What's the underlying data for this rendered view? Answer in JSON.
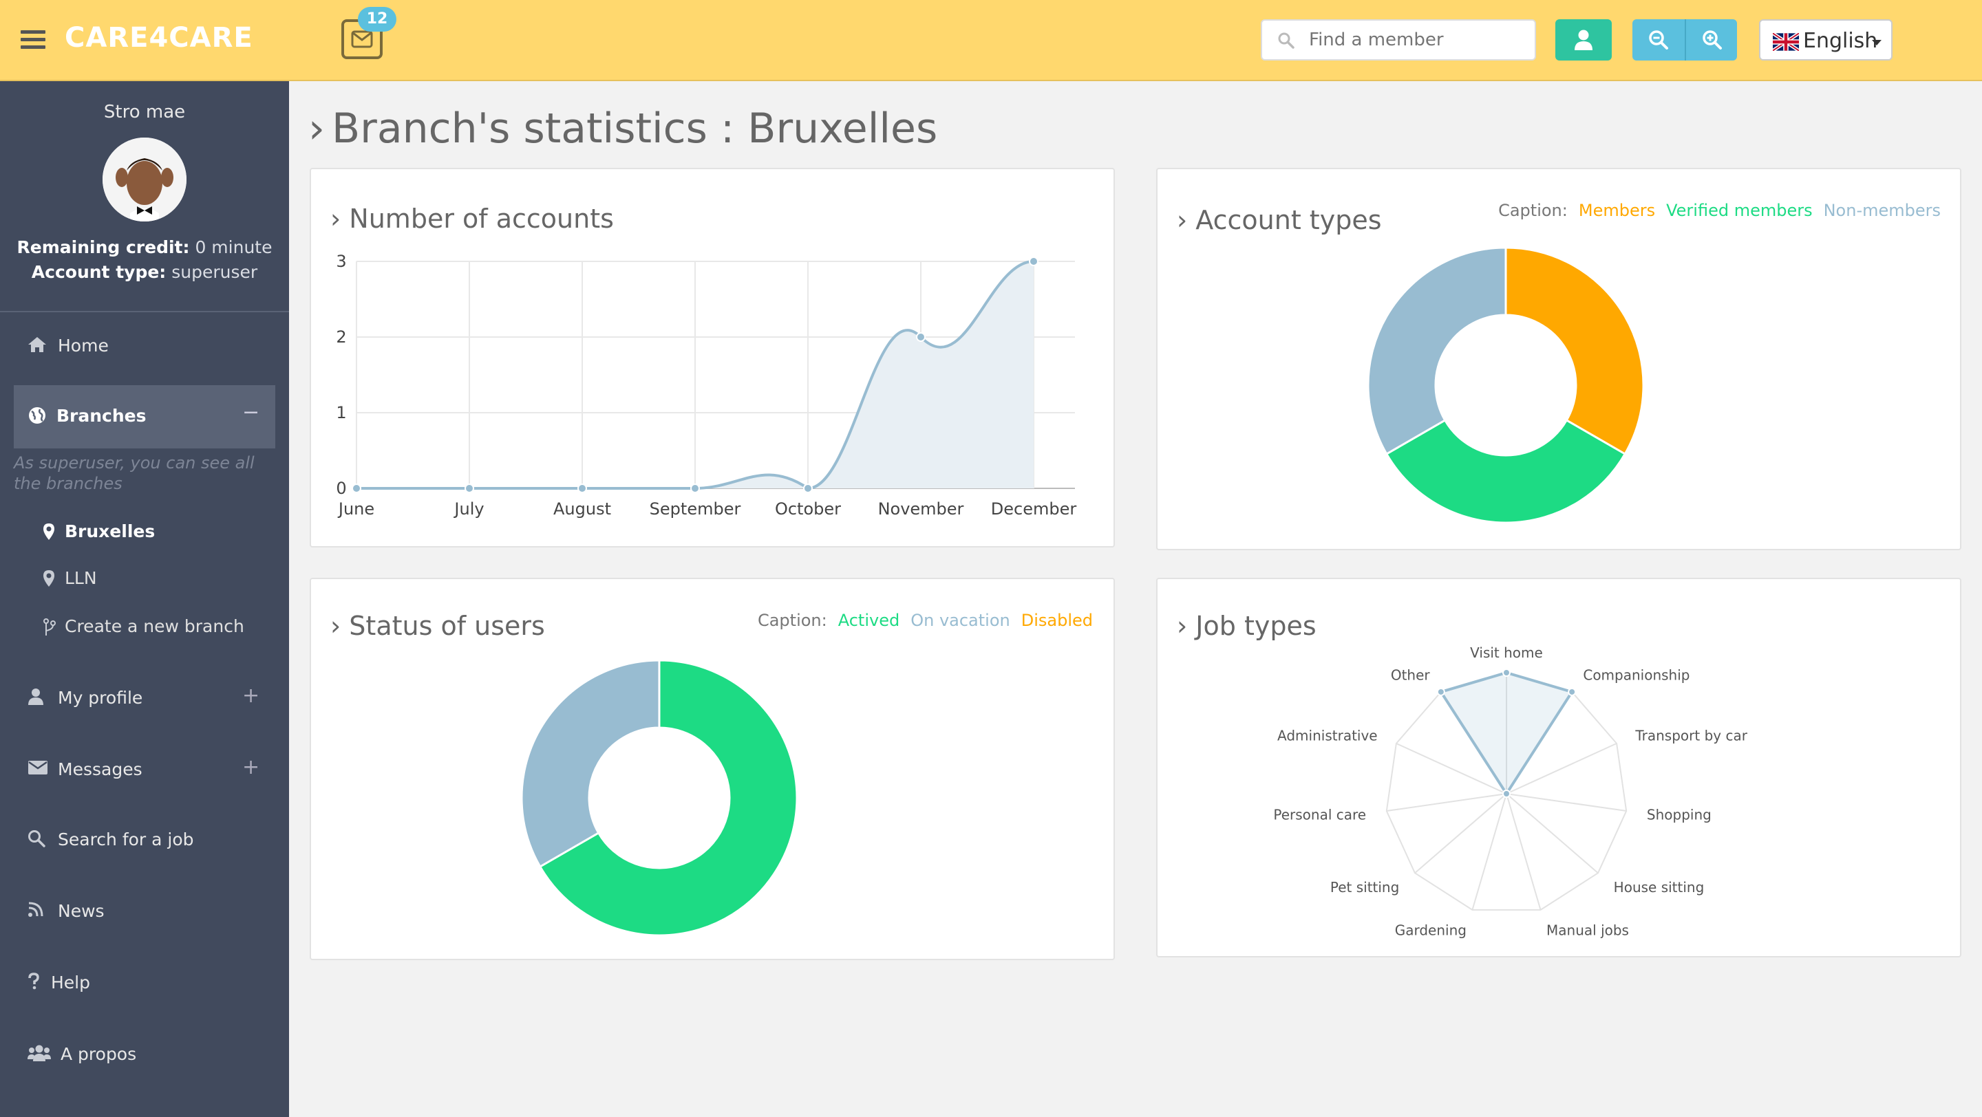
{
  "header": {
    "brand": "CARE4CARE",
    "mail_count": "12",
    "search_placeholder": "Find a member",
    "language": "English"
  },
  "sidebar": {
    "user_name": "Stro mae",
    "credit_label": "Remaining credit:",
    "credit_value": "0 minute",
    "account_type_label": "Account type:",
    "account_type_value": "superuser",
    "items": [
      {
        "label": "Home",
        "icon": "home-icon"
      },
      {
        "label": "Branches",
        "icon": "globe-icon",
        "toggle": "−"
      },
      {
        "label": "My profile",
        "icon": "user-icon",
        "toggle": "+"
      },
      {
        "label": "Messages",
        "icon": "envelope-icon",
        "toggle": "+"
      },
      {
        "label": "Search for a job",
        "icon": "search-icon"
      },
      {
        "label": "News",
        "icon": "rss-icon"
      },
      {
        "label": "Help",
        "icon": "question-icon"
      },
      {
        "label": "A propos",
        "icon": "users-icon"
      }
    ],
    "branch_note": "As superuser, you can see all the branches",
    "branches": [
      {
        "label": "Bruxelles",
        "icon": "map-marker-icon"
      },
      {
        "label": "LLN",
        "icon": "map-marker-icon"
      },
      {
        "label": "Create a new branch",
        "icon": "branch-icon"
      }
    ]
  },
  "main": {
    "title": "Branch's statistics : Bruxelles",
    "caption_label": "Caption:"
  },
  "chart_data": [
    {
      "type": "area",
      "title": "Number of accounts",
      "categories": [
        "June",
        "July",
        "August",
        "September",
        "October",
        "November",
        "December"
      ],
      "values": [
        0,
        0,
        0,
        0,
        0,
        2,
        3
      ],
      "ylim": [
        0,
        3
      ],
      "yticks": [
        "0",
        "1",
        "2",
        "3"
      ],
      "grid": true,
      "color": "#98bcd1"
    },
    {
      "type": "pie",
      "title": "Account types",
      "caption": [
        "Members",
        "Verified members",
        "Non-members"
      ],
      "categories": [
        "Members",
        "Verified members",
        "Non-members"
      ],
      "values": [
        1,
        1,
        1
      ],
      "colors": [
        "#ffa800",
        "#1ddb84",
        "#98bcd1"
      ]
    },
    {
      "type": "pie",
      "title": "Status of users",
      "caption": [
        "Actived",
        "On vacation",
        "Disabled"
      ],
      "categories": [
        "Actived",
        "On vacation",
        "Disabled"
      ],
      "values": [
        2,
        1,
        0
      ],
      "colors": [
        "#1ddb84",
        "#98bcd1",
        "#ffa800"
      ]
    },
    {
      "type": "radar",
      "title": "Job types",
      "categories": [
        "Visit home",
        "Companionship",
        "Transport by car",
        "Shopping",
        "House sitting",
        "Manual jobs",
        "Gardening",
        "Pet sitting",
        "Personal care",
        "Administrative",
        "Other"
      ],
      "values": [
        1,
        1,
        0,
        0,
        0,
        0,
        0,
        0,
        0,
        0,
        1
      ],
      "rmax": 1,
      "color": "#98bcd1"
    }
  ]
}
